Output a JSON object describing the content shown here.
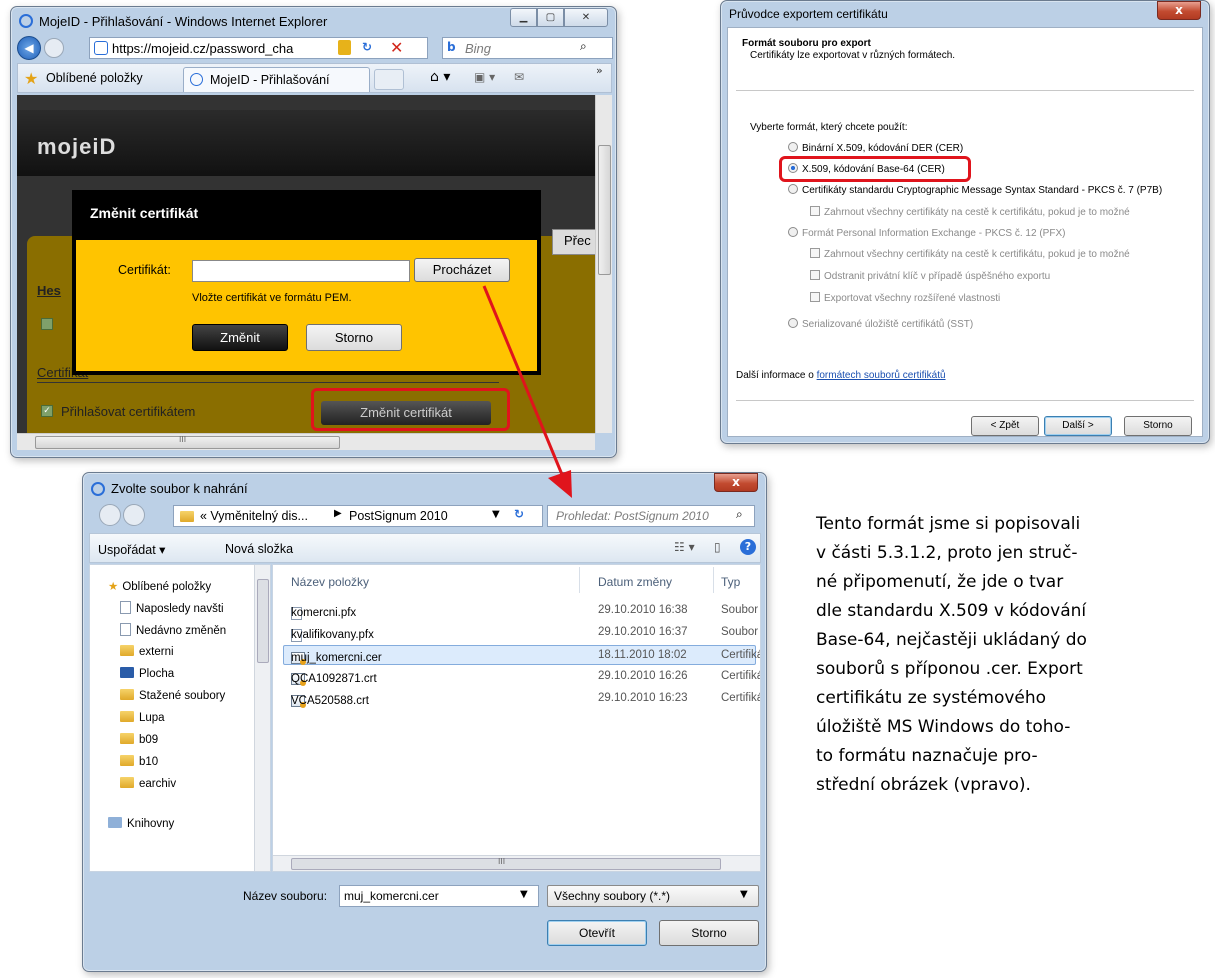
{
  "ie": {
    "title": "MojeID - Přihlašování - Windows Internet Explorer",
    "url": "https://mojeid.cz/password_cha",
    "search": "Bing",
    "favorites": "Oblíbené položky",
    "tab": "MojeID - Přihlašování",
    "logo": "mojeiD",
    "modal_title": "Změnit certifikát",
    "cert_label": "Certifikát:",
    "browse": "Procházet",
    "hint": "Vložte certifikát ve formátu PEM.",
    "change": "Změnit",
    "cancel": "Storno",
    "side_hes": "Hes",
    "tab_prec": "Přec",
    "section_cert": "Certifikát",
    "login_cert": "Přihlašovat certifikátem",
    "change_cert_btn": "Změnit certifikát",
    "scroll_label": "III"
  },
  "wiz": {
    "title": "Průvodce exportem certifikátu",
    "head": "Formát souboru pro export",
    "sub": "Certifikáty lze exportovat v různých formátech.",
    "choose": "Vyberte formát, který chcete použít:",
    "opt1": "Binární X.509, kódování DER (CER)",
    "opt2": "X.509, kódování Base-64 (CER)",
    "opt3": "Certifikáty standardu Cryptographic Message Syntax Standard - PKCS č. 7 (P7B)",
    "opt3a": "Zahrnout všechny certifikáty na cestě k certifikátu, pokud je to možné",
    "opt4": "Formát Personal Information Exchange - PKCS č. 12 (PFX)",
    "opt4a": "Zahrnout všechny certifikáty na cestě k certifikátu, pokud je to možné",
    "opt4b": "Odstranit privátní klíč v případě úspěšného exportu",
    "opt4c": "Exportovat všechny rozšířené vlastnosti",
    "opt5": "Serializované úložiště certifikátů (SST)",
    "more_prefix": "Další informace o ",
    "more_link": "formátech souborů certifikátů",
    "back": "< Zpět",
    "next": "Další >",
    "cancel": "Storno",
    "close": "x"
  },
  "dlg": {
    "title": "Zvolte soubor k nahrání",
    "close": "x",
    "breadcrumb": [
      "« Vyměnitelný dis...",
      "PostSignum 2010"
    ],
    "search_ph": "Prohledat: PostSignum 2010",
    "organize": "Uspořádat ▾",
    "new_folder": "Nová složka",
    "nav": [
      "Oblíbené položky",
      "Naposledy navšti",
      "Nedávno změněn",
      "externi",
      "Plocha",
      "Stažené soubory",
      "Lupa",
      "b09",
      "b10",
      "earchiv",
      "Knihovny"
    ],
    "cols": [
      "Název položky",
      "Datum změny",
      "Typ"
    ],
    "files": [
      {
        "name": "komercni.pfx",
        "date": "29.10.2010 16:38",
        "type": "Soubor PF"
      },
      {
        "name": "kvalifikovany.pfx",
        "date": "29.10.2010 16:37",
        "type": "Soubor PF"
      },
      {
        "name": "muj_komercni.cer",
        "date": "18.11.2010 18:02",
        "type": "Certifikát"
      },
      {
        "name": "QCA1092871.crt",
        "date": "29.10.2010 16:26",
        "type": "Certifikát"
      },
      {
        "name": "VCA520588.crt",
        "date": "29.10.2010 16:23",
        "type": "Certifikát"
      }
    ],
    "filename_label": "Název souboru:",
    "filename": "muj_komercni.cer",
    "filter": "Všechny soubory (*.*)",
    "open": "Otevřít",
    "cancel": "Storno",
    "hscroll": "III"
  },
  "text": [
    "Tento formát jsme si popisovali",
    "v části 5.3.1.2, proto jen struč-",
    "né připomenutí, že jde o tvar",
    "dle standardu X.509 v kódování",
    "Base-64, nejčastěji ukládaný do",
    "souborů s příponou .cer. Export",
    "certifikátu ze systémového",
    "úložiště MS Windows do toho-",
    "to formátu naznačuje pro-",
    "střední obrázek (vpravo)."
  ],
  "colors": {
    "accent_red": "#e0141c",
    "mojeid_yellow": "#ffc400",
    "dark_band": "#333333"
  }
}
